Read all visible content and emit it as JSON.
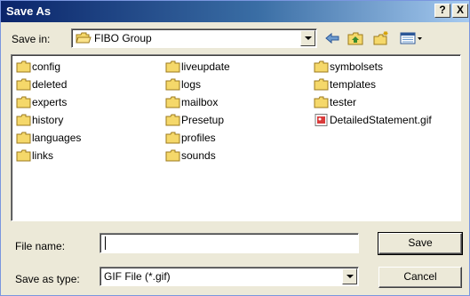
{
  "window": {
    "title": "Save As",
    "help_label": "?",
    "close_label": "X"
  },
  "location": {
    "label": "Save in:",
    "value": "FIBO Group"
  },
  "toolbar": {
    "icons": [
      "back-arrow-icon",
      "up-folder-icon",
      "new-folder-icon",
      "views-menu-icon"
    ]
  },
  "files": [
    {
      "name": "config",
      "type": "folder"
    },
    {
      "name": "deleted",
      "type": "folder"
    },
    {
      "name": "experts",
      "type": "folder"
    },
    {
      "name": "history",
      "type": "folder"
    },
    {
      "name": "languages",
      "type": "folder"
    },
    {
      "name": "links",
      "type": "folder"
    },
    {
      "name": "liveupdate",
      "type": "folder"
    },
    {
      "name": "logs",
      "type": "folder"
    },
    {
      "name": "mailbox",
      "type": "folder"
    },
    {
      "name": "Presetup",
      "type": "folder"
    },
    {
      "name": "profiles",
      "type": "folder"
    },
    {
      "name": "sounds",
      "type": "folder"
    },
    {
      "name": "symbolsets",
      "type": "folder"
    },
    {
      "name": "templates",
      "type": "folder"
    },
    {
      "name": "tester",
      "type": "folder"
    },
    {
      "name": "DetailedStatement.gif",
      "type": "gif"
    }
  ],
  "filename": {
    "label": "File name:",
    "value": ""
  },
  "filetype": {
    "label": "Save as type:",
    "value": "GIF File (*.gif)"
  },
  "buttons": {
    "save": "Save",
    "cancel": "Cancel"
  },
  "colors": {
    "title_start": "#0a246a",
    "title_end": "#a6caf0",
    "dialog_bg": "#ece9d8",
    "folder": "#f5d86a"
  }
}
